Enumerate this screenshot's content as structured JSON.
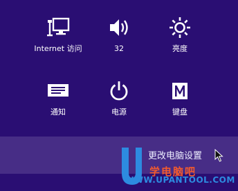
{
  "charms_settings": {
    "tiles": [
      {
        "label": "Internet 访问",
        "icon": "network-icon"
      },
      {
        "label": "32",
        "icon": "volume-icon"
      },
      {
        "label": "亮度",
        "icon": "brightness-icon"
      },
      {
        "label": "通知",
        "icon": "notifications-icon"
      },
      {
        "label": "电源",
        "icon": "power-icon"
      },
      {
        "label": "键盘",
        "icon": "keyboard-icon"
      }
    ],
    "change_pc_settings_label": "更改电脑设置"
  },
  "watermark": {
    "logo_text": "U",
    "site_name": "学电脑吧",
    "url": "WWW.UPANTOOL.COM"
  },
  "colors": {
    "background": "#2a0e73",
    "watermark_red": "#f35a2e",
    "watermark_blue": "#2d8be0"
  }
}
